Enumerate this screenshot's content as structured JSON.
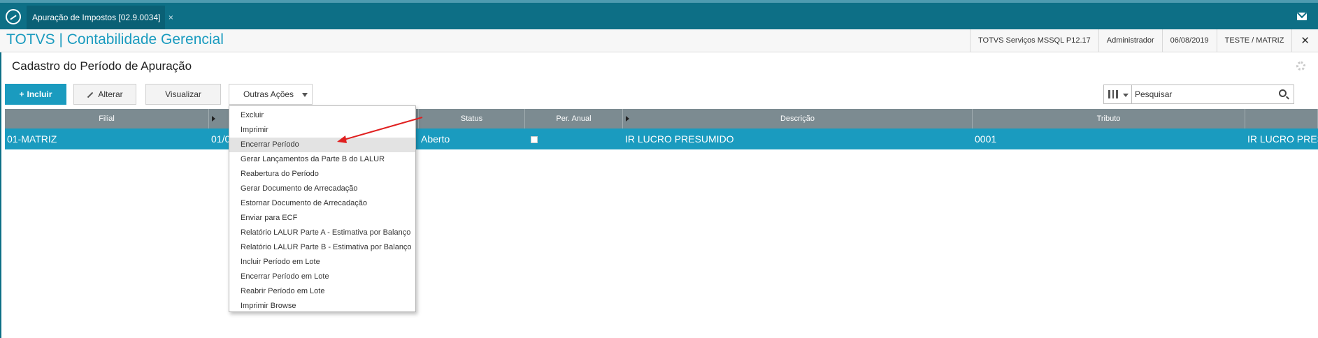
{
  "window": {
    "tab_title": "Apuração de Impostos [02.9.0034]",
    "tab_close": "×"
  },
  "module": {
    "title": "TOTVS | Contabilidade Gerencial",
    "environment": "TOTVS Serviços MSSQL P12.17",
    "user": "Administrador",
    "date": "06/08/2019",
    "company": "TESTE / MATRIZ",
    "close": "✕"
  },
  "page": {
    "title": "Cadastro do Período de Apuração"
  },
  "toolbar": {
    "incluir_plus": "+",
    "incluir": "Incluir",
    "alterar": "Alterar",
    "visualizar": "Visualizar",
    "outras_acoes": "Outras Ações"
  },
  "search": {
    "value": "Pesquisar"
  },
  "grid": {
    "columns": [
      "Filial",
      "",
      "Status",
      "Per. Anual",
      "Descrição",
      "Tributo",
      ""
    ],
    "row": {
      "filial": "01-MATRIZ",
      "date": "01/0",
      "status": "Aberto",
      "descricao": "IR LUCRO PRESUMIDO",
      "tributo": "0001",
      "extra": "IR LUCRO PRES"
    }
  },
  "menu": {
    "items": [
      "Excluir",
      "Imprimir",
      "Encerrar Período",
      "Gerar Lançamentos da Parte B do LALUR",
      "Reabertura do Período",
      "Gerar Documento de Arrecadação",
      "Estornar Documento de Arrecadação",
      "Enviar para ECF",
      "Relatório LALUR Parte A - Estimativa por Balanço",
      "Relatório LALUR Parte B - Estimativa por Balanço",
      "Incluir Período em Lote",
      "Encerrar Período em Lote",
      "Reabrir Período em Lote",
      "Imprimir Browse"
    ]
  },
  "colors": {
    "accent": "#1a9bbf",
    "topbar": "#0d6f86",
    "grid_header": "#7c8b91",
    "annotation": "#e02020"
  }
}
